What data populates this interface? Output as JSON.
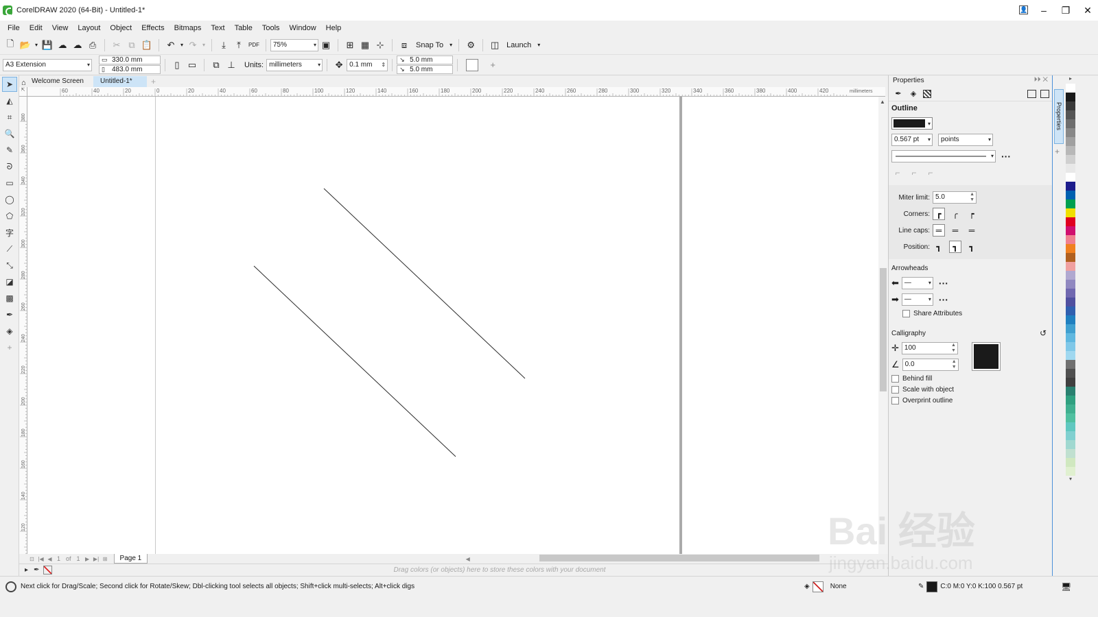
{
  "window": {
    "title": "CorelDRAW 2020 (64-Bit) - Untitled-1*"
  },
  "menu": [
    "File",
    "Edit",
    "View",
    "Layout",
    "Object",
    "Effects",
    "Bitmaps",
    "Text",
    "Table",
    "Tools",
    "Window",
    "Help"
  ],
  "toolbar": {
    "zoom": "75%",
    "snap_to": "Snap To",
    "launch": "Launch"
  },
  "property_bar": {
    "page_size": "A3 Extension",
    "width": "330.0 mm",
    "height": "483.0 mm",
    "units_label": "Units:",
    "units": "millimeters",
    "nudge": "0.1 mm",
    "dup_x": "5.0 mm",
    "dup_y": "5.0 mm"
  },
  "doc_tabs": {
    "welcome": "Welcome Screen",
    "doc": "Untitled-1*"
  },
  "rulers": {
    "h_labels": [
      "60",
      "40",
      "20",
      "0",
      "20",
      "40",
      "60",
      "80",
      "100",
      "120",
      "140",
      "160",
      "180",
      "200",
      "220",
      "240",
      "260",
      "280",
      "300",
      "320",
      "340",
      "360",
      "380",
      "400",
      "420"
    ],
    "h_unit": "millimeters",
    "v_labels": [
      "380",
      "360",
      "340",
      "320",
      "300",
      "280",
      "260",
      "240",
      "220",
      "200",
      "180",
      "160",
      "140",
      "120"
    ]
  },
  "page_nav": {
    "current": "1",
    "of": "of",
    "total": "1",
    "page_tab": "Page 1"
  },
  "palette_hint": "Drag colors (or objects) here to store these colors with your document",
  "status": {
    "message": "Next click for Drag/Scale; Second click for Rotate/Skew; Dbl-clicking tool selects all objects; Shift+click multi-selects; Alt+click digs",
    "fill": "None",
    "outline": "C:0 M:0 Y:0 K:100  0.567 pt"
  },
  "properties": {
    "title": "Properties",
    "section_outline": "Outline",
    "width_value": "0.567 pt",
    "width_units": "points",
    "miter_label": "Miter limit:",
    "miter_value": "5.0",
    "corners_label": "Corners:",
    "linecaps_label": "Line caps:",
    "position_label": "Position:",
    "arrowheads_title": "Arrowheads",
    "share_attributes": "Share Attributes",
    "calligraphy_title": "Calligraphy",
    "stretch": "100",
    "angle": "0.0",
    "behind_fill": "Behind fill",
    "scale_with_object": "Scale with object",
    "overprint_outline": "Overprint outline",
    "side_tab": "Properties"
  },
  "palette_colors": [
    "#ffffff",
    "#1a1a1a",
    "#3a3a3a",
    "#555555",
    "#6e6e6e",
    "#888888",
    "#a0a0a0",
    "#b8b8b8",
    "#d0d0d0",
    "#e8e8e8",
    "#ffffff",
    "#1c1c8c",
    "#0060b0",
    "#00a050",
    "#f0e000",
    "#e00020",
    "#d01070",
    "#f08090",
    "#f08020",
    "#b06020",
    "#f0a0a0",
    "#b0a8d0",
    "#9088c0",
    "#7068b0",
    "#5050a0",
    "#3060b0",
    "#2080c0",
    "#40a0d0",
    "#60b8e0",
    "#80c8e8",
    "#a0d8f0",
    "#707070",
    "#505050",
    "#404040",
    "#2a8070",
    "#30a080",
    "#40b090",
    "#50c0a0",
    "#60c8c0",
    "#80d0d0",
    "#a0d8d0",
    "#c0e0d0",
    "#d0e8c0",
    "#e0f0d0"
  ],
  "watermark": {
    "text": "Bai 经验",
    "sub": "jingyan.baidu.com"
  },
  "colors": {
    "accent": "#cde4f7",
    "accent_border": "#4a90d9",
    "outline": "#1a1a1a"
  }
}
